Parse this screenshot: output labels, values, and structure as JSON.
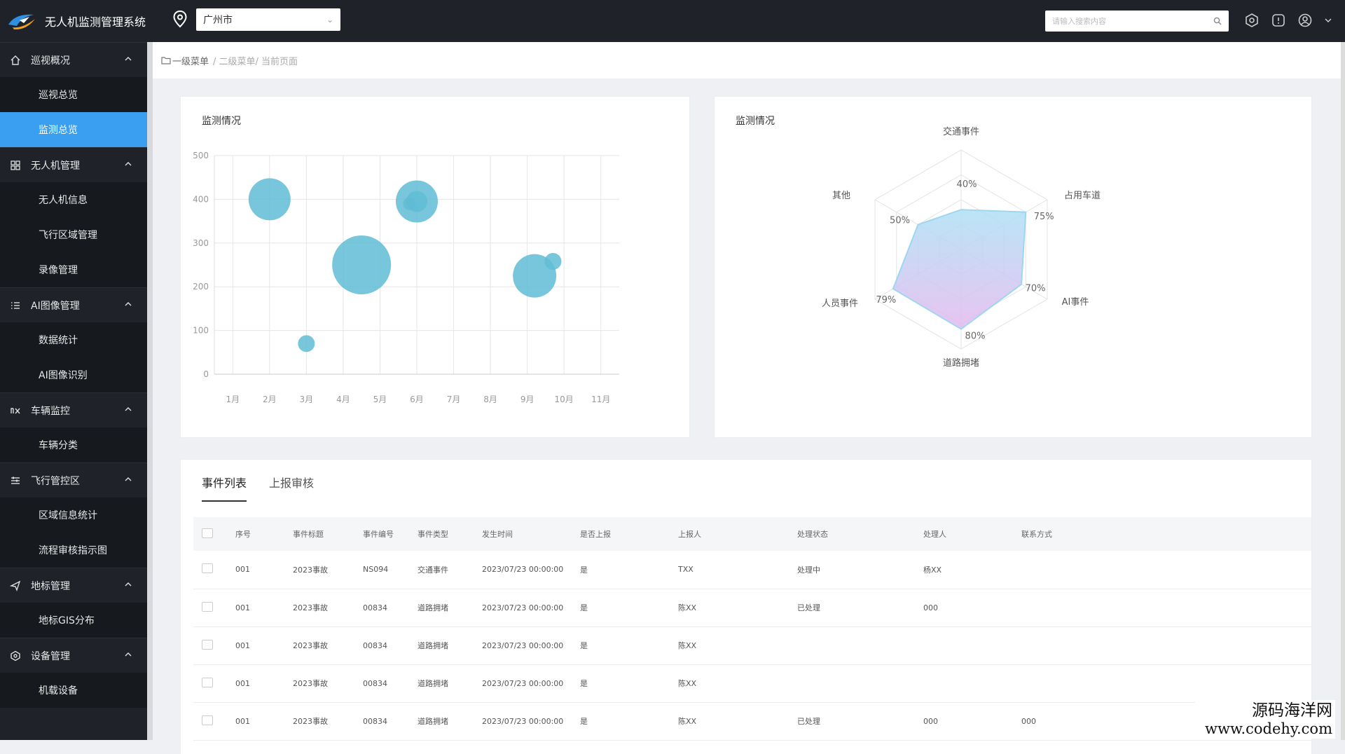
{
  "app": {
    "title": "无人机监测管理系统"
  },
  "header": {
    "city": "广州市",
    "search_placeholder": "请输入搜索内容",
    "icons": [
      "help-icon",
      "message-icon",
      "user-icon",
      "chevron-down-icon"
    ]
  },
  "sidebar": {
    "groups": [
      {
        "label": "巡视概况",
        "icon": "home-icon",
        "items": [
          "巡视总览",
          "监测总览"
        ]
      },
      {
        "label": "无人机管理",
        "icon": "grid-icon",
        "items": [
          "无人机信息",
          "飞行区域管理",
          "录像管理"
        ]
      },
      {
        "label": "AI图像管理",
        "icon": "list-icon",
        "items": [
          "数据统计",
          "AI图像识别"
        ]
      },
      {
        "label": "车辆监控",
        "icon": "car-icon",
        "items": [
          "车辆分类"
        ]
      },
      {
        "label": "飞行管控区",
        "icon": "sliders-icon",
        "items": [
          "区域信息统计",
          "流程审核指示图"
        ]
      },
      {
        "label": "地标管理",
        "icon": "send-icon",
        "items": [
          "地标GIS分布"
        ]
      },
      {
        "label": "设备管理",
        "icon": "device-icon",
        "items": [
          "机载设备"
        ]
      }
    ],
    "active_item": "监测总览"
  },
  "breadcrumb": {
    "level1": "一级菜单",
    "rest": "/ 二级菜单/ 当前页面"
  },
  "bubble_card": {
    "title": "监测情况"
  },
  "radar_card": {
    "title": "监测情况"
  },
  "chart_data": [
    {
      "type": "scatter",
      "subtype": "bubble",
      "title": "监测情况",
      "categories": [
        "1月",
        "2月",
        "3月",
        "4月",
        "5月",
        "6月",
        "7月",
        "8月",
        "9月",
        "10月",
        "11月"
      ],
      "ylim": [
        0,
        500
      ],
      "yticks": [
        0,
        100,
        200,
        300,
        400,
        500
      ],
      "grid": true,
      "color": "#5fbcd5",
      "points": [
        {
          "x": "2月",
          "y": 400,
          "size": 30
        },
        {
          "x": "3月",
          "y": 70,
          "size": 12
        },
        {
          "x": "4.5月",
          "y": 250,
          "size": 42
        },
        {
          "x": "6月",
          "y": 395,
          "size": 30
        },
        {
          "x": "6月",
          "y": 395,
          "size": 15
        },
        {
          "x": "5.8月",
          "y": 390,
          "size": 9
        },
        {
          "x": "9.2月",
          "y": 225,
          "size": 31
        },
        {
          "x": "9.7月",
          "y": 258,
          "size": 12
        }
      ]
    },
    {
      "type": "radar",
      "title": "监测情况",
      "axes": [
        "交通事件",
        "占用车道",
        "AI事件",
        "道路拥堵",
        "人员事件",
        "其他"
      ],
      "values": [
        40,
        75,
        70,
        80,
        79,
        50
      ],
      "value_labels": [
        "40%",
        "75%",
        "70%",
        "80%",
        "79%",
        "50%"
      ],
      "max": 100,
      "levels": 4,
      "colors": {
        "stroke": "#9fd6ef",
        "fill_top": "#aee0f5",
        "fill_bottom": "#e3b9ee"
      }
    }
  ],
  "events": {
    "tabs": [
      "事件列表",
      "上报审核"
    ],
    "active_tab": "事件列表",
    "columns": [
      "序号",
      "事件标题",
      "事件编号",
      "事件类型",
      "发生时间",
      "是否上报",
      "上报人",
      "处理状态",
      "处理人",
      "联系方式"
    ],
    "rows": [
      [
        "001",
        "2023事故",
        "NS094",
        "交通事件",
        "2023/07/23 00:00:00",
        "是",
        "TXX",
        "处理中",
        "杨XX",
        ""
      ],
      [
        "001",
        "2023事故",
        "00834",
        "道路拥堵",
        "2023/07/23 00:00:00",
        "是",
        "陈XX",
        "已处理",
        "000",
        ""
      ],
      [
        "001",
        "2023事故",
        "00834",
        "道路拥堵",
        "2023/07/23 00:00:00",
        "是",
        "陈XX",
        "",
        "",
        ""
      ],
      [
        "001",
        "2023事故",
        "00834",
        "道路拥堵",
        "2023/07/23 00:00:00",
        "是",
        "陈XX",
        "",
        "",
        ""
      ],
      [
        "001",
        "2023事故",
        "00834",
        "道路拥堵",
        "2023/07/23 00:00:00",
        "是",
        "陈XX",
        "已处理",
        "000",
        "000"
      ]
    ]
  },
  "watermark": {
    "line1": "源码海洋网",
    "line2": "www.codehy.com"
  }
}
